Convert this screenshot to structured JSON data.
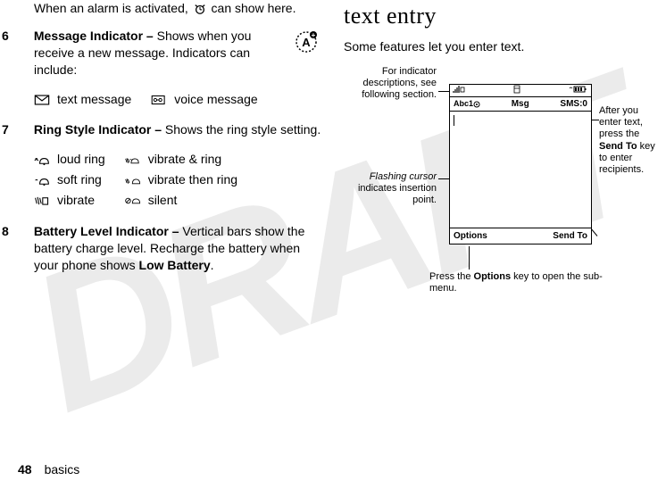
{
  "watermark": "DRAFT",
  "left_column": {
    "alarm_sentence_pre": "When an alarm is activated, ",
    "alarm_sentence_post": " can show here.",
    "item6_num": "6",
    "item6_title": "Message Indicator – ",
    "item6_body": "Shows when you receive a new message. Indicators can include:",
    "msg_icons": {
      "text": "text message",
      "voice": "voice message"
    },
    "item7_num": "7",
    "item7_title": "Ring Style Indicator – ",
    "item7_body": "Shows the ring style setting.",
    "ring_icons": {
      "loud": "loud ring",
      "vibrate_ring": "vibrate & ring",
      "soft": "soft ring",
      "vibrate_then_ring": "vibrate then ring",
      "vibrate": "vibrate",
      "silent": "silent"
    },
    "item8_num": "8",
    "item8_title": "Battery Level Indicator – ",
    "item8_body_pre": "Vertical bars show the battery charge level. Recharge the battery when your phone shows ",
    "item8_body_bold": "Low Battery",
    "item8_body_post": "."
  },
  "right_column": {
    "heading": "text entry",
    "intro": "Some features let you enter text.",
    "callouts": {
      "top_left": "For indicator descriptions, see following section.",
      "mid_left_italic": "Flashing cursor",
      "mid_left_rest": " indicates insertion point.",
      "right_pre": "After you enter text, press the ",
      "right_bold": "Send To",
      "right_post": " key to enter recipients.",
      "bottom_pre": "Press the ",
      "bottom_bold": "Options",
      "bottom_post": " key to open the sub-menu."
    },
    "screen": {
      "mode": "Abc1",
      "title": "Msg",
      "counter": "SMS:0",
      "softleft": "Options",
      "softright": "Send To"
    }
  },
  "footer": {
    "page": "48",
    "section": "basics"
  }
}
